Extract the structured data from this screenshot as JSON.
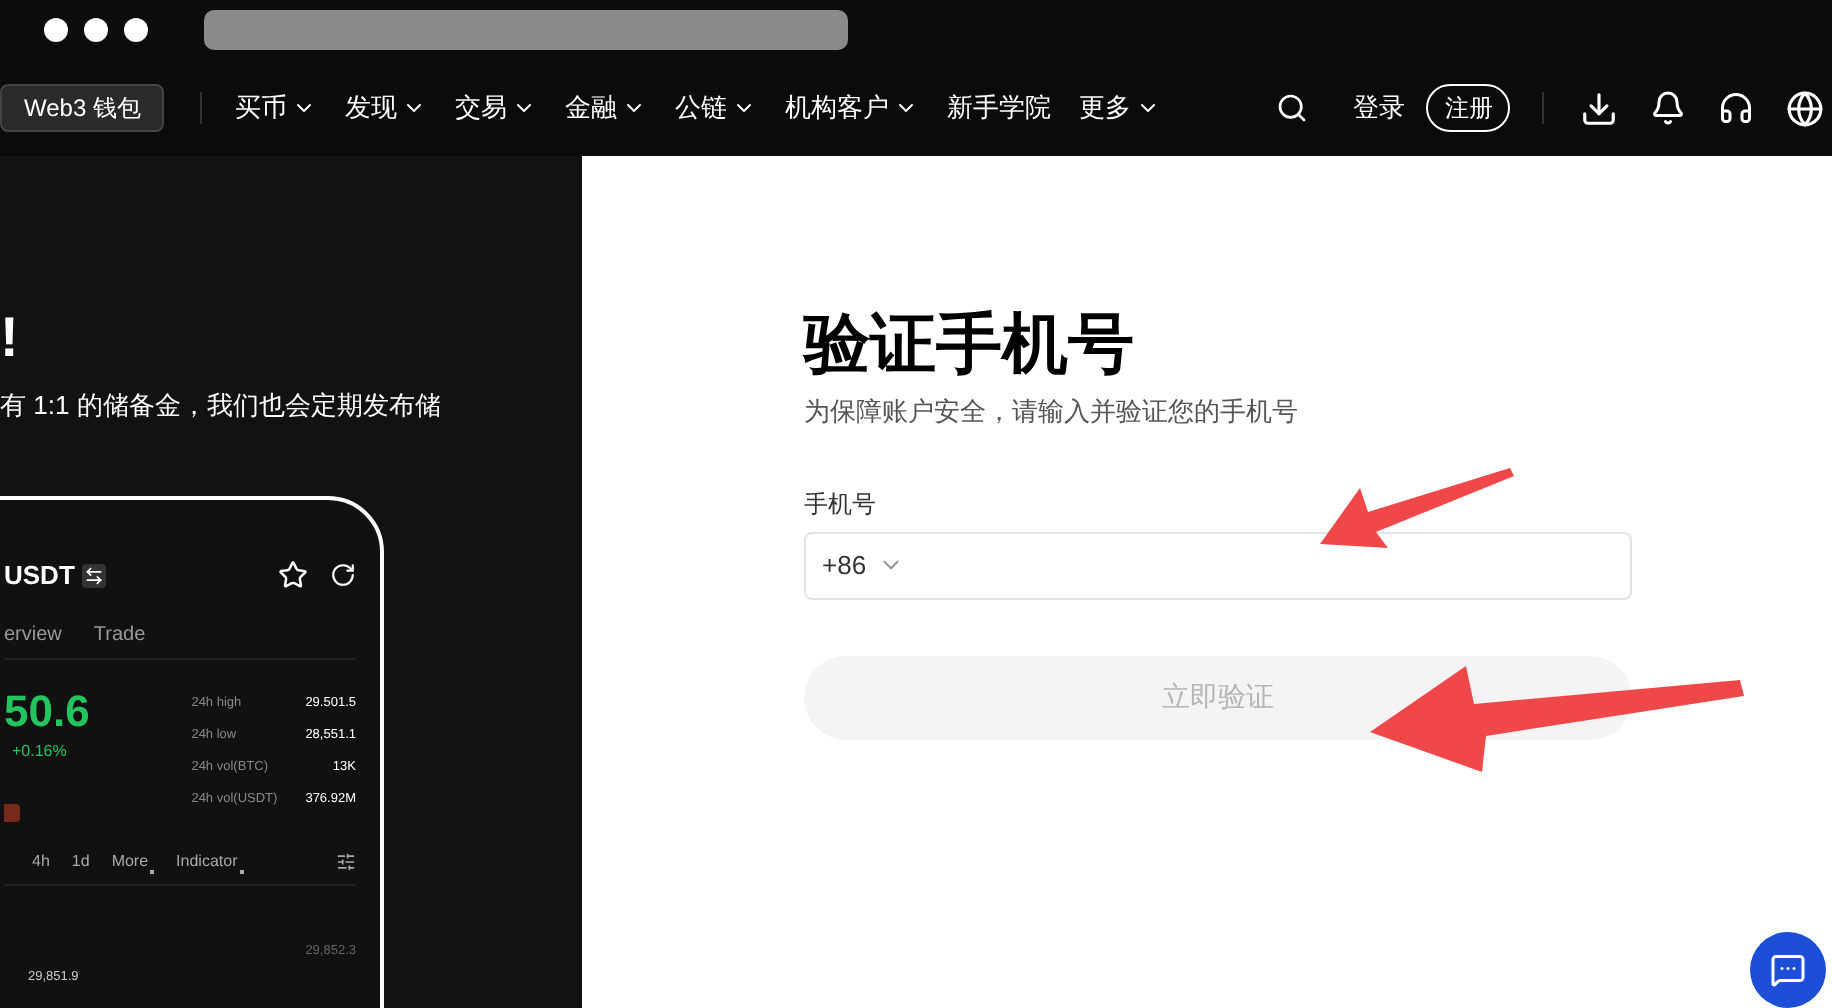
{
  "nav": {
    "wallet_button": "Web3 钱包",
    "items": [
      {
        "label": "买币",
        "dropdown": true
      },
      {
        "label": "发现",
        "dropdown": true
      },
      {
        "label": "交易",
        "dropdown": true
      },
      {
        "label": "金融",
        "dropdown": true
      },
      {
        "label": "公链",
        "dropdown": true
      },
      {
        "label": "机构客户",
        "dropdown": true
      },
      {
        "label": "新手学院",
        "dropdown": false
      },
      {
        "label": "更多",
        "dropdown": true
      }
    ],
    "login": "登录",
    "register": "注册"
  },
  "hero": {
    "heading": "!",
    "description": "有 1:1 的储备金，我们也会定期发布储"
  },
  "phone": {
    "pair": "USDT",
    "tabs": [
      "erview",
      "Trade"
    ],
    "price": "50.6",
    "change": "+0.16%",
    "stats": [
      {
        "label": "24h high",
        "value": "29.501.5"
      },
      {
        "label": "24h low",
        "value": "28,551.1"
      },
      {
        "label": "24h vol(BTC)",
        "value": "13K"
      },
      {
        "label": "24h vol(USDT)",
        "value": "376.92M"
      }
    ],
    "intervals": [
      {
        "label": "4h",
        "dropdown": false
      },
      {
        "label": "1d",
        "dropdown": false
      },
      {
        "label": "More",
        "dropdown": true
      },
      {
        "label": "Indicator",
        "dropdown": true
      }
    ],
    "chart_high": "29,852.3",
    "chart_point": "29,851.9"
  },
  "form": {
    "title": "验证手机号",
    "subtitle": "为保障账户安全，请输入并验证您的手机号",
    "phone_label": "手机号",
    "country_code": "+86",
    "submit": {
      "label": "立即验证",
      "disabled": true
    }
  }
}
